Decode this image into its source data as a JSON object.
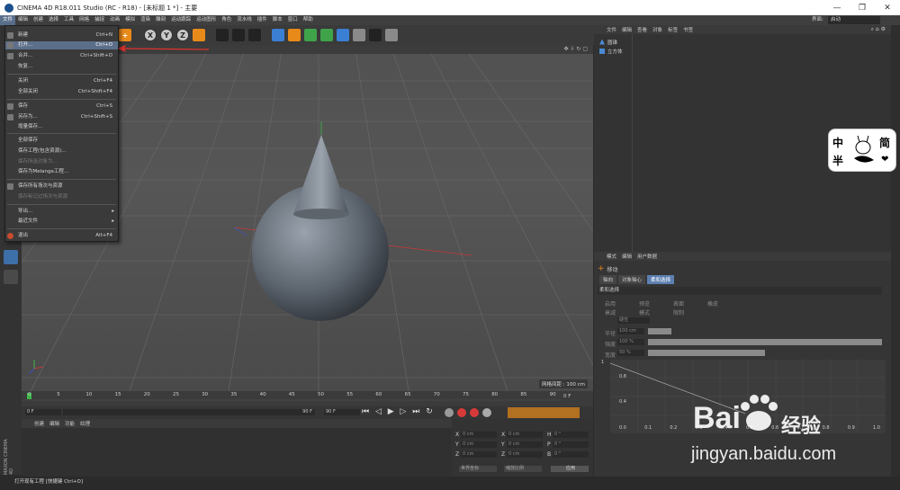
{
  "window": {
    "title": "CINEMA 4D R18.011 Studio (RC - R18) - [未标题 1 *] - 主要",
    "controls": [
      "—",
      "❐",
      "✕"
    ]
  },
  "menubar": {
    "items": [
      "文件",
      "编辑",
      "创建",
      "选择",
      "工具",
      "网格",
      "捕捉",
      "动画",
      "模拟",
      "渲染",
      "雕刻",
      "运动跟踪",
      "运动图形",
      "角色",
      "流水线",
      "插件",
      "脚本",
      "窗口",
      "帮助"
    ],
    "layout_label": "界面:",
    "layout_value": "启动"
  },
  "file_menu": {
    "items": [
      {
        "label": "新建",
        "shortcut": "Ctrl+N",
        "state": "normal"
      },
      {
        "label": "打开...",
        "shortcut": "Ctrl+O",
        "state": "highlight"
      },
      {
        "label": "合并...",
        "shortcut": "Ctrl+Shift+O",
        "state": "normal"
      },
      {
        "label": "恢复...",
        "shortcut": "",
        "state": "normal"
      },
      {
        "label": "关闭",
        "shortcut": "Ctrl+F4",
        "state": "normal"
      },
      {
        "label": "全部关闭",
        "shortcut": "Ctrl+Shift+F4",
        "state": "normal"
      },
      {
        "label": "保存",
        "shortcut": "Ctrl+S",
        "state": "normal"
      },
      {
        "label": "另存为...",
        "shortcut": "Ctrl+Shift+S",
        "state": "normal"
      },
      {
        "label": "增量保存...",
        "shortcut": "",
        "state": "normal"
      },
      {
        "label": "全部保存",
        "shortcut": "",
        "state": "normal"
      },
      {
        "label": "保存工程(包含资源)...",
        "shortcut": "",
        "state": "normal"
      },
      {
        "label": "保存所选对象为...",
        "shortcut": "",
        "state": "disabled"
      },
      {
        "label": "保存为Melange工程...",
        "shortcut": "",
        "state": "normal"
      },
      {
        "label": "保存所有场次与资源",
        "shortcut": "",
        "state": "normal"
      },
      {
        "label": "保存标记过场次与资源",
        "shortcut": "",
        "state": "disabled"
      },
      {
        "label": "导出...",
        "shortcut": "",
        "state": "submenu"
      },
      {
        "label": "最近文件",
        "shortcut": "",
        "state": "submenu"
      },
      {
        "label": "退出",
        "shortcut": "Alt+F4",
        "state": "normal"
      }
    ]
  },
  "viewport": {
    "grid_info": "网格间距 : 100 cm"
  },
  "timeline": {
    "ticks": [
      "0",
      "5",
      "10",
      "15",
      "20",
      "25",
      "30",
      "35",
      "40",
      "45",
      "50",
      "55",
      "60",
      "65",
      "70",
      "75",
      "80",
      "85",
      "90"
    ],
    "end_frame": "0 F"
  },
  "transport": {
    "start": "0 F",
    "current": "0 F",
    "end1": "90 F",
    "end2": "90 F"
  },
  "material_panel": {
    "tabs": [
      "创建",
      "编辑",
      "功能",
      "纹理"
    ]
  },
  "coords": {
    "rows": [
      {
        "a": "X",
        "av": "0 cm",
        "b": "X",
        "bv": "0 cm",
        "c": "H",
        "cv": "0 °"
      },
      {
        "a": "Y",
        "av": "0 cm",
        "b": "Y",
        "bv": "0 cm",
        "c": "P",
        "cv": "0 °"
      },
      {
        "a": "Z",
        "av": "0 cm",
        "b": "Z",
        "bv": "0 cm",
        "c": "B",
        "cv": "0 °"
      }
    ],
    "world": "世界坐标",
    "scale": "缩放比例",
    "apply": "应用"
  },
  "object_panel": {
    "tabs": [
      "文件",
      "编辑",
      "查看",
      "对象",
      "标签",
      "书签"
    ],
    "objects": [
      "圆锥",
      "立方体"
    ]
  },
  "attr_panel": {
    "tabs": [
      "模式",
      "编辑",
      "用户数据"
    ],
    "tool": "移动",
    "subtabs": [
      "轴向",
      "对象轴心",
      "柔和选择"
    ],
    "section": "柔和选择",
    "fields": [
      "启用",
      "预览",
      "衰减",
      "模式",
      "限制",
      "硬性",
      "半径",
      "100 cm",
      "强度",
      "100 %",
      "宽度",
      "50 %",
      "表面",
      "橡皮"
    ],
    "graph_y": [
      "1",
      "0.8",
      "0.4"
    ],
    "graph_x": [
      "0.0",
      "0.1",
      "0.2",
      "0.3",
      "0.4",
      "0.5",
      "0.6",
      "0.7",
      "0.8",
      "0.9",
      "1.0"
    ]
  },
  "status": {
    "text": "打开现有工程 [快捷键 Ctrl+O]"
  },
  "badge": {
    "a": "中",
    "b": "简",
    "c": "半",
    "d": "❤"
  },
  "watermark": {
    "brand": "Bai",
    "brand2": "经验",
    "url": "jingyan.baidu.com"
  },
  "toolbar": {
    "x": "X",
    "y": "Y",
    "z": "Z"
  },
  "colors": {
    "menu_highlight": "#5c6f8a",
    "arrow": "#e0322d",
    "axis_red": "#c23a3a",
    "axis_green": "#3fb64a",
    "axis_blue": "#4252b8"
  }
}
